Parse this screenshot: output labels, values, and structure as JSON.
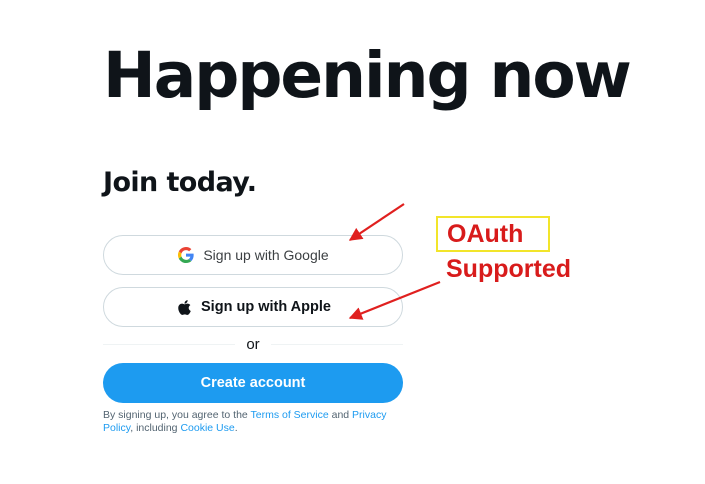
{
  "hero": {
    "headline": "Happening now",
    "subheadline": "Join today."
  },
  "signup": {
    "google_label": "Sign up with Google",
    "apple_label": "Sign up with Apple",
    "divider_text": "or",
    "create_label": "Create account"
  },
  "legal": {
    "prefix": "By signing up, you agree to the ",
    "terms_link": "Terms of Service",
    "and": " and ",
    "privacy_link": "Privacy Policy",
    "including": ", including ",
    "cookie_link": "Cookie Use",
    "suffix": "."
  },
  "annotation": {
    "title": "OAuth",
    "subtitle": "Supported",
    "color": "#d81b1b",
    "box_border_color": "#f2e52a"
  },
  "colors": {
    "primary": "#1d9bf0",
    "text": "#0f1419",
    "muted": "#536471",
    "border": "#cfd9de"
  },
  "icons": {
    "google": "google-g-icon",
    "apple": "apple-logo-icon"
  }
}
